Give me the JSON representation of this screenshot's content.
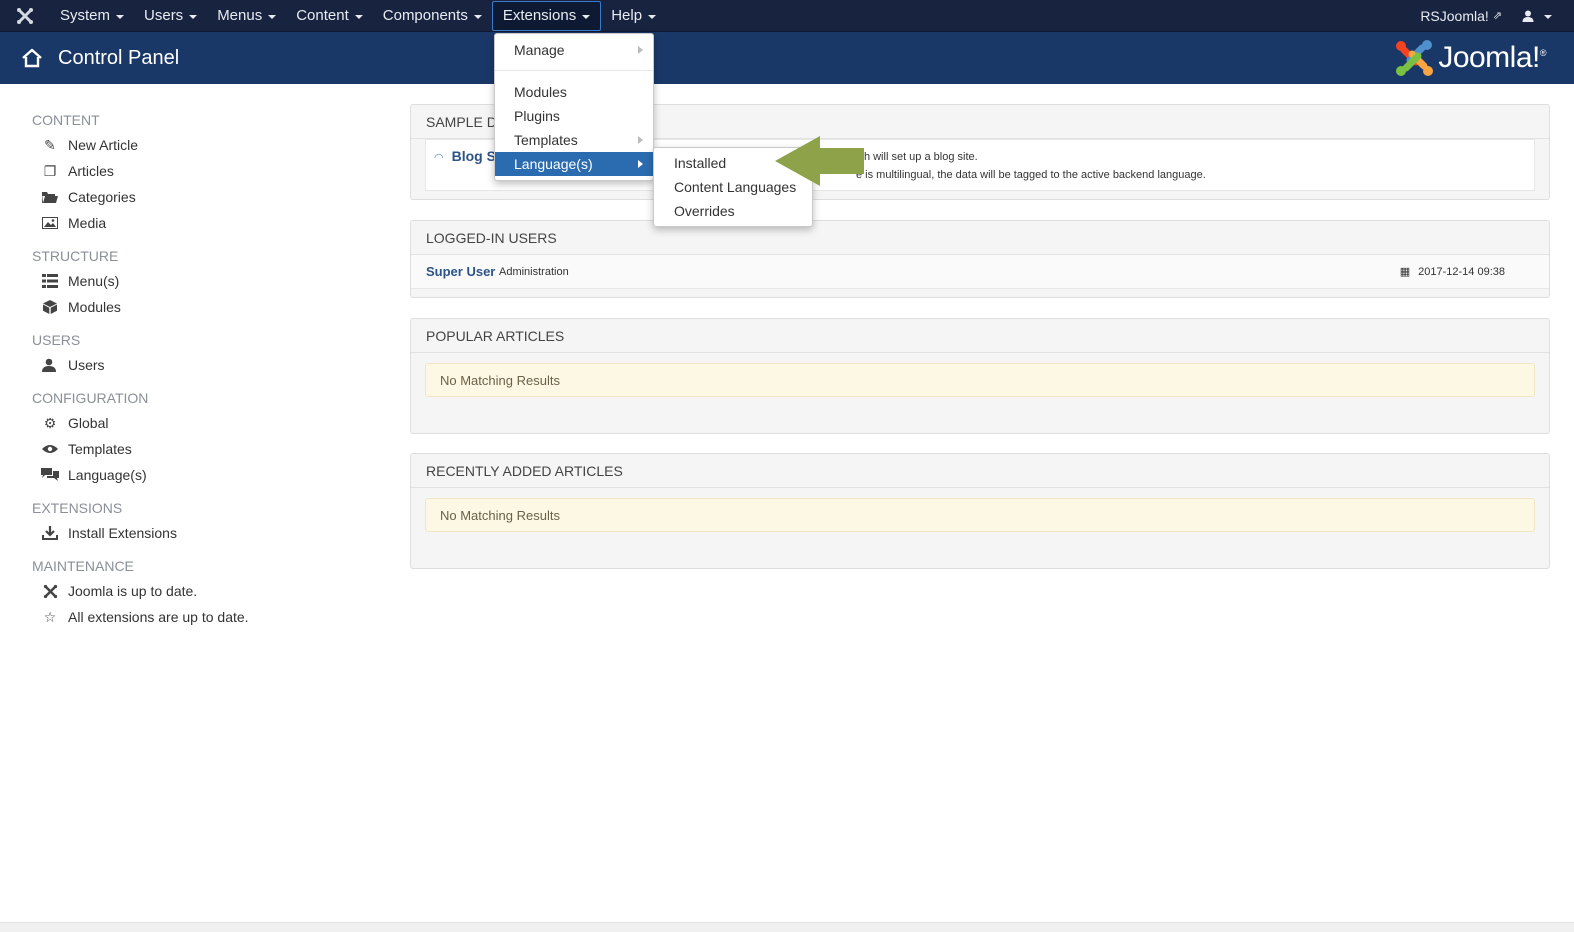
{
  "topnav": {
    "items": [
      {
        "label": "System"
      },
      {
        "label": "Users"
      },
      {
        "label": "Menus"
      },
      {
        "label": "Content"
      },
      {
        "label": "Components"
      },
      {
        "label": "Extensions"
      },
      {
        "label": "Help"
      }
    ],
    "site_link": "RSJoomla!"
  },
  "header": {
    "title": "Control Panel",
    "brand": "Joomla!"
  },
  "sidebar": {
    "sections": [
      {
        "heading": "CONTENT",
        "items": [
          {
            "label": "New Article",
            "icon": "pencil-icon"
          },
          {
            "label": "Articles",
            "icon": "copy-icon"
          },
          {
            "label": "Categories",
            "icon": "folder-icon"
          },
          {
            "label": "Media",
            "icon": "image-icon"
          }
        ]
      },
      {
        "heading": "STRUCTURE",
        "items": [
          {
            "label": "Menu(s)",
            "icon": "list-icon"
          },
          {
            "label": "Modules",
            "icon": "cube-icon"
          }
        ]
      },
      {
        "heading": "USERS",
        "items": [
          {
            "label": "Users",
            "icon": "users-icon"
          }
        ]
      },
      {
        "heading": "CONFIGURATION",
        "items": [
          {
            "label": "Global",
            "icon": "cog-icon"
          },
          {
            "label": "Templates",
            "icon": "eye-icon"
          },
          {
            "label": "Language(s)",
            "icon": "comments-icon"
          }
        ]
      },
      {
        "heading": "EXTENSIONS",
        "items": [
          {
            "label": "Install Extensions",
            "icon": "download-icon"
          }
        ]
      },
      {
        "heading": "MAINTENANCE",
        "items": [
          {
            "label": "Joomla is up to date.",
            "icon": "joomla-icon"
          },
          {
            "label": "All extensions are up to date.",
            "icon": "star-icon"
          }
        ]
      }
    ]
  },
  "panels": {
    "sample": {
      "heading": "SAMPLE DA",
      "link": "Blog S",
      "desc1": "ich will set up a blog site.",
      "desc2": "e is multilingual, the data will be tagged to the active backend language."
    },
    "logged": {
      "heading": "LOGGED-IN USERS",
      "user": "Super User",
      "role": "Administration",
      "time": "2017-12-14 09:38"
    },
    "popular": {
      "heading": "POPULAR ARTICLES",
      "message": "No Matching Results"
    },
    "recent": {
      "heading": "RECENTLY ADDED ARTICLES",
      "message": "No Matching Results"
    }
  },
  "extensions_menu": {
    "items": [
      "Manage",
      "Modules",
      "Plugins",
      "Templates",
      "Language(s)"
    ]
  },
  "language_menu": {
    "items": [
      "Installed",
      "Content Languages",
      "Overrides"
    ]
  },
  "colors": {
    "topbar": "#17233f",
    "header": "#1a3867",
    "accent": "#2b6cb0",
    "arrow": "#8ea24a"
  }
}
